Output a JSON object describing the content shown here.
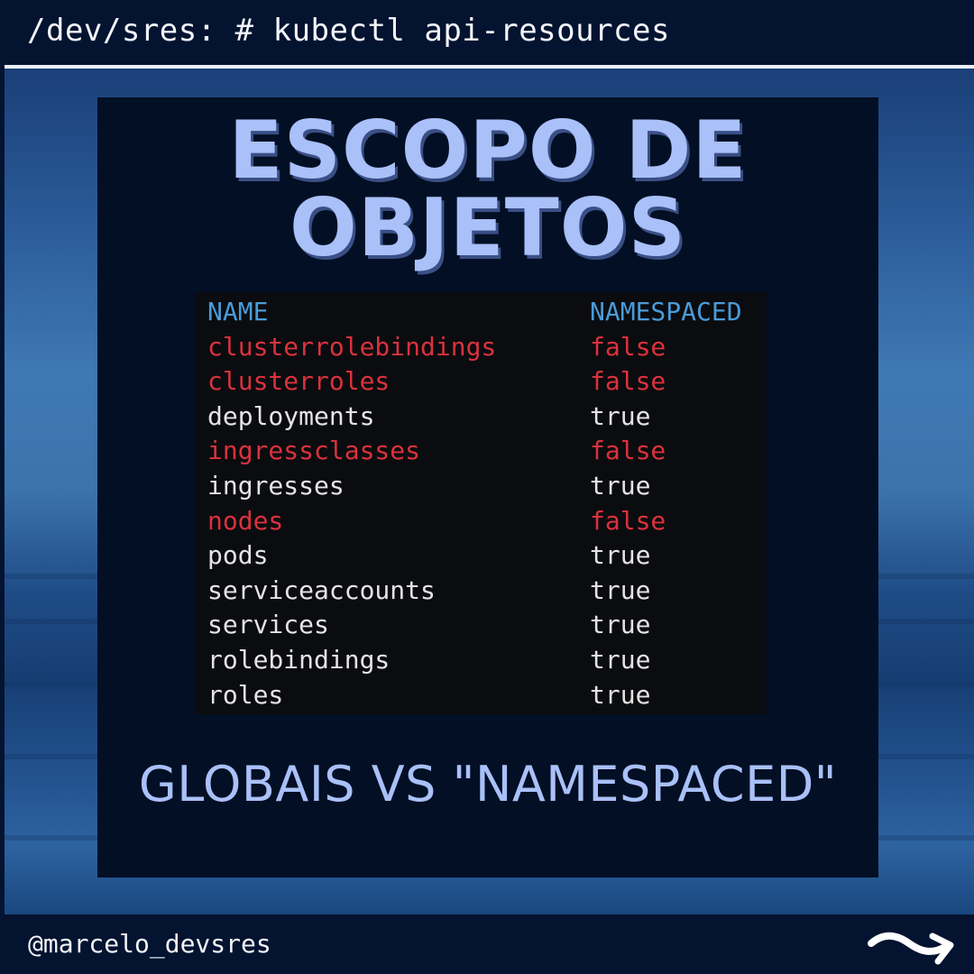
{
  "header": {
    "prompt": "/dev/sres: # kubectl api-resources"
  },
  "panel": {
    "title_line1": "ESCOPO DE",
    "title_line2": "OBJETOS",
    "subtitle": "GLOBAIS VS \"NAMESPACED\""
  },
  "table": {
    "columns": [
      "NAME",
      "NAMESPACED"
    ],
    "rows": [
      {
        "name": "clusterrolebindings",
        "namespaced": "false"
      },
      {
        "name": "clusterroles",
        "namespaced": "false"
      },
      {
        "name": "deployments",
        "namespaced": "true"
      },
      {
        "name": "ingressclasses",
        "namespaced": "false"
      },
      {
        "name": "ingresses",
        "namespaced": "true"
      },
      {
        "name": "nodes",
        "namespaced": "false"
      },
      {
        "name": "pods",
        "namespaced": "true"
      },
      {
        "name": "serviceaccounts",
        "namespaced": "true"
      },
      {
        "name": "services",
        "namespaced": "true"
      },
      {
        "name": "rolebindings",
        "namespaced": "true"
      },
      {
        "name": "roles",
        "namespaced": "true"
      }
    ]
  },
  "colors": {
    "header_text": "#4a9bd9",
    "cluster_scoped": "#d9323d",
    "namespaced": "#e4e4e4",
    "title": "#a9c0f8"
  },
  "footer": {
    "handle": "@marcelo_devsres",
    "icon": "swipe-arrow-icon"
  }
}
